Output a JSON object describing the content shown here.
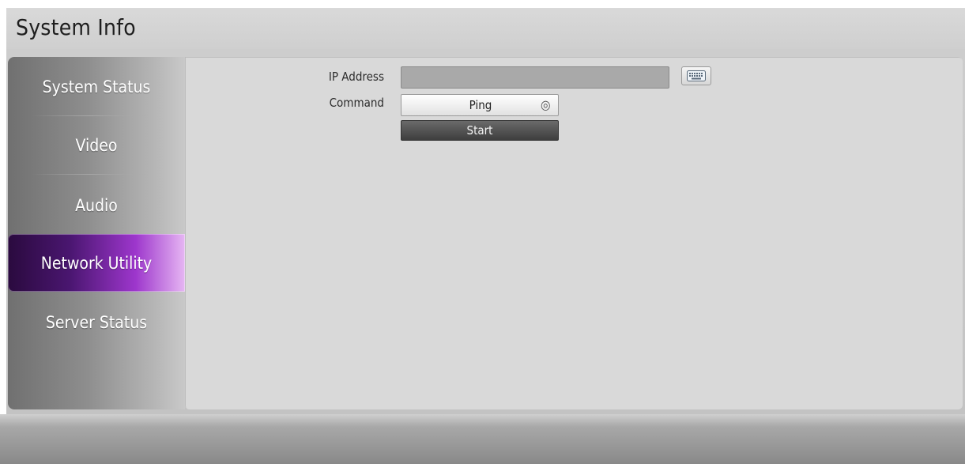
{
  "header": {
    "title": "System Info"
  },
  "sidebar": {
    "items": [
      {
        "label": "System Status"
      },
      {
        "label": "Video"
      },
      {
        "label": "Audio"
      },
      {
        "label": "Network Utility"
      },
      {
        "label": "Server Status"
      }
    ]
  },
  "form": {
    "ip_address_label": "IP Address",
    "ip_address_value": "",
    "command_label": "Command",
    "command_value": "Ping",
    "start_label": "Start"
  },
  "icons": {
    "keyboard": "keyboard-icon",
    "select_ring": "ring-icon"
  },
  "colors": {
    "active_accent": "#9d36cc",
    "active_dark": "#2a0a3e"
  }
}
